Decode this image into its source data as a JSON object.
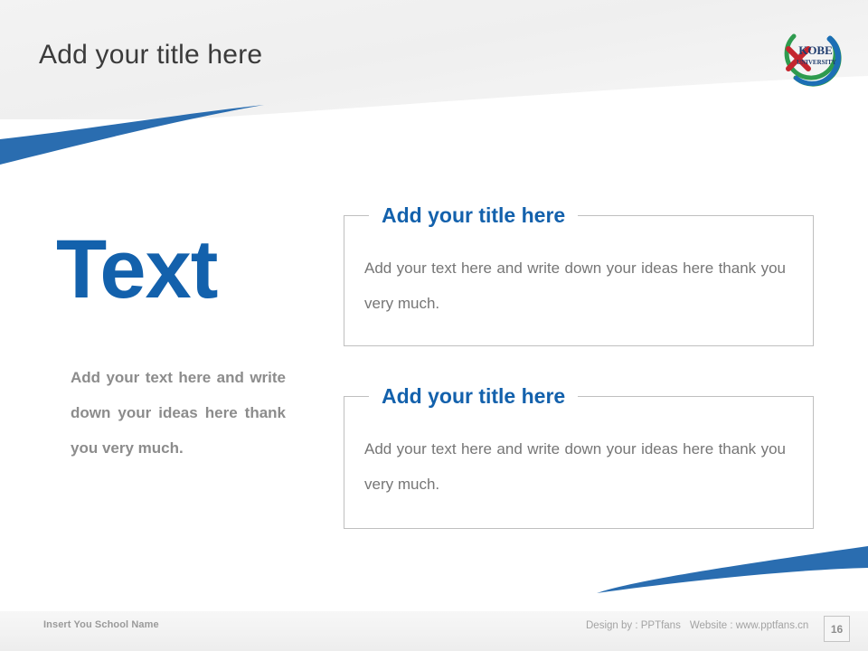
{
  "slide": {
    "title": "Add your title here",
    "page_number": "16",
    "accent_color": "#1361AC",
    "body_gray": "#767676",
    "left_gray": "#8C8C8C"
  },
  "logo": {
    "name": "kobe-university-logo",
    "line1": "KOBE",
    "line2": "UNIVERSITY",
    "ring_green": "#2E9B4E",
    "ring_blue": "#1C6FB5",
    "mark_red": "#C4262E",
    "text_color": "#1F3C6E"
  },
  "left_column": {
    "headline": "Text",
    "body": "Add your text here and write down your ideas here thank you very much."
  },
  "boxes": [
    {
      "title": "Add your title here",
      "body": "Add your text here and write down your ideas here thank you very much."
    },
    {
      "title": "Add your title here",
      "body": "Add your text here and write down your ideas here thank you very much."
    }
  ],
  "footer": {
    "school_name": "Insert You School Name",
    "design_by": "Design by : PPTfans",
    "website": "Website : www.pptfans.cn"
  }
}
